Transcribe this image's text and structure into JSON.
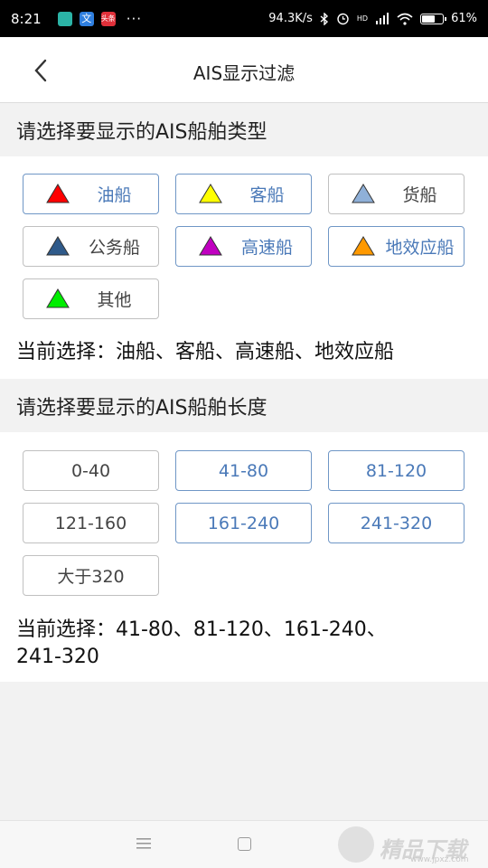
{
  "status_bar": {
    "time": "8:21",
    "app_icons": [
      {
        "name": "app-icon-teal",
        "color": "#2bb3a6"
      },
      {
        "name": "app-icon-blue",
        "color": "#2f7fe0",
        "text": "文"
      },
      {
        "name": "app-icon-red",
        "color": "#e0303a",
        "text": "头条"
      }
    ],
    "more_dots": "···",
    "network_speed": "94.3K/s",
    "signal_text": "HD",
    "battery_text": "61%",
    "battery_level": 0.61
  },
  "header": {
    "back_icon": "back-arrow-icon",
    "title": "AIS显示过滤"
  },
  "ship_type_section": {
    "title": "请选择要显示的AIS船舶类型",
    "options": [
      {
        "label": "油船",
        "color": "#ff0000",
        "selected": true
      },
      {
        "label": "客船",
        "color": "#ffff00",
        "selected": true
      },
      {
        "label": "货船",
        "color": "#8fb0d8",
        "selected": false
      },
      {
        "label": "公务船",
        "color": "#2f5a8a",
        "selected": false
      },
      {
        "label": "高速船",
        "color": "#c000c0",
        "selected": true
      },
      {
        "label": "地效应船",
        "color": "#ff9900",
        "selected": true
      },
      {
        "label": "其他",
        "color": "#00ee00",
        "selected": false
      }
    ],
    "current_selection": "当前选择：油船、客船、高速船、地效应船"
  },
  "ship_length_section": {
    "title": "请选择要显示的AIS船舶长度",
    "options": [
      {
        "label": "0-40",
        "selected": false
      },
      {
        "label": "41-80",
        "selected": true
      },
      {
        "label": "81-120",
        "selected": true
      },
      {
        "label": "121-160",
        "selected": false
      },
      {
        "label": "161-240",
        "selected": true
      },
      {
        "label": "241-320",
        "selected": true
      },
      {
        "label": "大于320",
        "selected": false
      }
    ],
    "current_selection_line1": "当前选择：41-80、81-120、161-240、",
    "current_selection_line2": "241-320"
  },
  "nav_bar": {
    "menu_icon": "menu-icon",
    "home_icon": "home-square-icon",
    "watermark_text": "精品下载",
    "watermark_sub": "www.jpxz.com"
  }
}
